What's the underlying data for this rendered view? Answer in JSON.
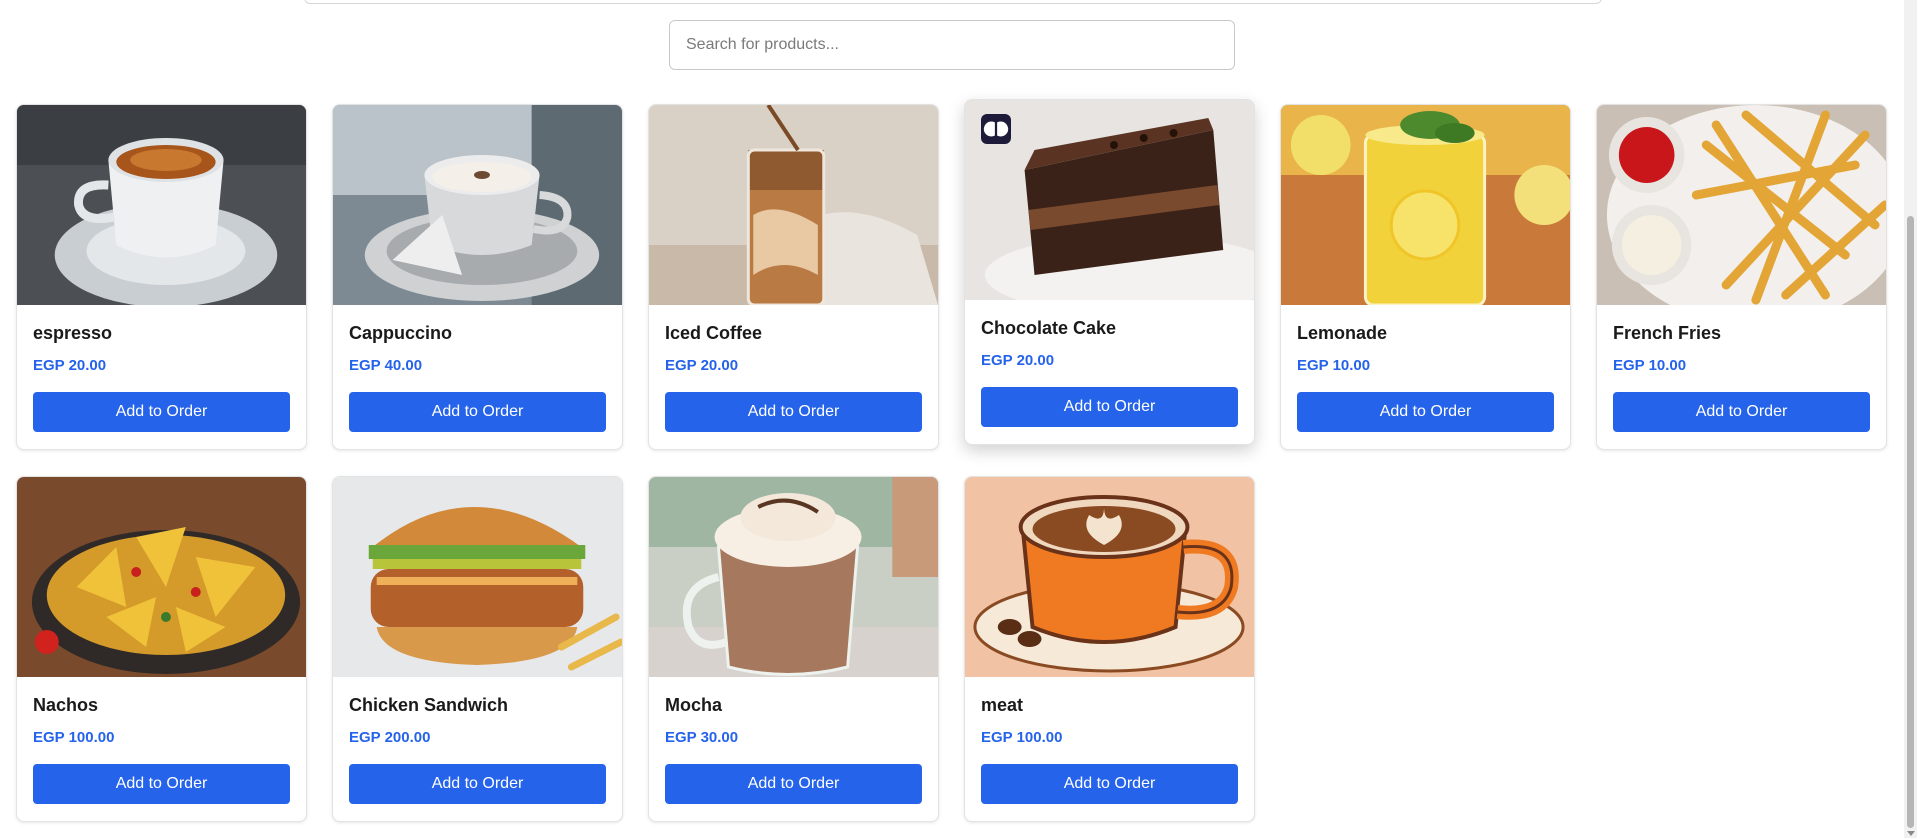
{
  "search": {
    "placeholder": "Search for products..."
  },
  "add_label": "Add to Order",
  "products": [
    {
      "name": "espresso",
      "price": "EGP 20.00",
      "image": "espresso-photo"
    },
    {
      "name": "Cappuccino",
      "price": "EGP 40.00",
      "image": "cappuccino-photo"
    },
    {
      "name": "Iced Coffee",
      "price": "EGP 20.00",
      "image": "iced-coffee-photo"
    },
    {
      "name": "Chocolate Cake",
      "price": "EGP 20.00",
      "image": "chocolate-cake-photo"
    },
    {
      "name": "Lemonade",
      "price": "EGP 10.00",
      "image": "lemonade-photo"
    },
    {
      "name": "French Fries",
      "price": "EGP 10.00",
      "image": "french-fries-photo"
    },
    {
      "name": "Nachos",
      "price": "EGP 100.00",
      "image": "nachos-photo"
    },
    {
      "name": "Chicken Sandwich",
      "price": "EGP 200.00",
      "image": "chicken-sandwich-photo"
    },
    {
      "name": "Mocha",
      "price": "EGP 30.00",
      "image": "mocha-photo"
    },
    {
      "name": "meat",
      "price": "EGP 100.00",
      "image": "latte-art-illustration"
    }
  ],
  "colors": {
    "accent": "#2563eb",
    "price": "#2563eb"
  }
}
